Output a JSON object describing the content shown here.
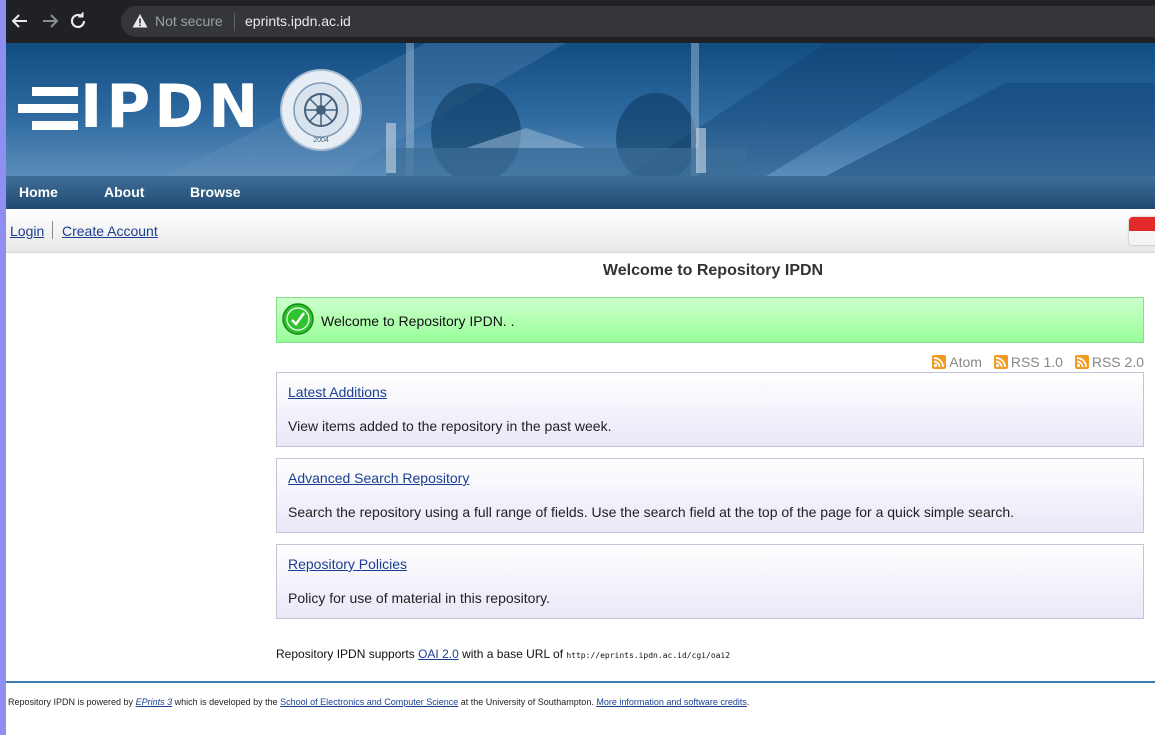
{
  "browser": {
    "security_label": "Not secure",
    "url": "eprints.ipdn.ac.id"
  },
  "header": {
    "logo_text": "IPDN",
    "seal_icon": "ipdn-seal",
    "seal_text_top": "INSTITUT PEMERINTAHAN DALAM NEGERI",
    "seal_year": "2004"
  },
  "menu": {
    "home": "Home",
    "about": "About",
    "browse": "Browse"
  },
  "account": {
    "login": "Login",
    "create": "Create Account"
  },
  "main": {
    "title": "Welcome to Repository IPDN",
    "welcome_message": "Welcome to Repository IPDN. .",
    "feeds": {
      "atom": "Atom",
      "rss1": "RSS 1.0",
      "rss2": "RSS 2.0"
    },
    "cards": [
      {
        "link": "Latest Additions",
        "description": "View items added to the repository in the past week."
      },
      {
        "link": "Advanced Search Repository",
        "description": "Search the repository using a full range of fields. Use the search field at the top of the page for a quick simple search."
      },
      {
        "link": "Repository Policies",
        "description": "Policy for use of material in this repository."
      }
    ],
    "oai": {
      "prefix": "Repository IPDN supports ",
      "link": "OAI 2.0",
      "middle": " with a base URL of ",
      "url": "http://eprints.ipdn.ac.id/cgi/oai2"
    }
  },
  "footer": {
    "t1": "Repository IPDN is powered by ",
    "eprints": "EPrints 3",
    "t2": " which is developed by the ",
    "school": "School of Electronics and Computer Science",
    "t3": " at the University of Southampton. ",
    "credits": "More information and software credits",
    "t4": "."
  },
  "colors": {
    "banner_blue": "#124d82",
    "link": "#1a3f8f",
    "success_green": "#99ff99",
    "rss_orange": "#f39a22"
  }
}
